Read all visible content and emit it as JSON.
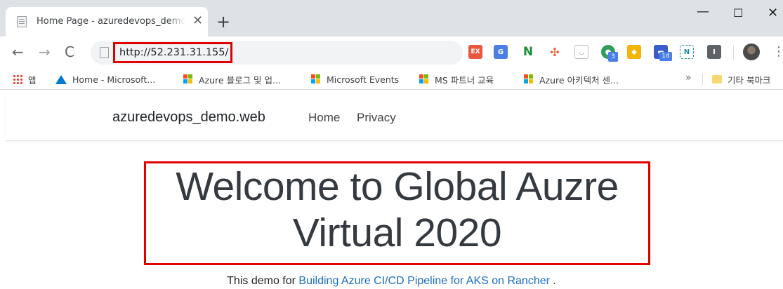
{
  "browser": {
    "tab": {
      "title": "Home Page - azuredevops_demo.web",
      "close_glyph": "✕"
    },
    "new_tab_glyph": "+",
    "window_controls": {
      "minimize": "—",
      "maximize": "☐",
      "close": "✕"
    },
    "toolbar": {
      "back_glyph": "←",
      "forward_glyph": "→",
      "reload_glyph": "C",
      "url": "http://52.231.31.155/",
      "menu_glyph": "⋮"
    },
    "extensions": [
      {
        "name": "ex-extension-icon",
        "label": "EX",
        "color": "#e8573f"
      },
      {
        "name": "translate-extension-icon",
        "label": "G",
        "color": "#4a7fe5"
      },
      {
        "name": "n-extension-icon",
        "label": "N",
        "color": "#1b8f3a"
      },
      {
        "name": "org-chart-extension-icon",
        "label": "✣",
        "color": "#e6562a"
      },
      {
        "name": "pocket-extension-icon",
        "label": "◡",
        "color": "#999999"
      },
      {
        "name": "chat-extension-icon",
        "label": "●",
        "color": "#2e9e5a",
        "badge": "3"
      },
      {
        "name": "puzzle-extension-icon",
        "label": "◆",
        "color": "#f5b400"
      },
      {
        "name": "calendar-extension-icon",
        "label": "▬",
        "color": "#3a5dc9",
        "badge": "1d"
      },
      {
        "name": "notion-extension-icon",
        "label": "N",
        "color": "#1a8aa8"
      },
      {
        "name": "reader-extension-icon",
        "label": "I",
        "color": "#5f6368"
      }
    ],
    "bookmarks": {
      "items": [
        {
          "label": "앱",
          "icon": "apps-grid-icon"
        },
        {
          "label": "Home - Microsoft...",
          "icon": "azure-logo-icon"
        },
        {
          "label": "Azure 블로그 및 업...",
          "icon": "microsoft-logo-icon"
        },
        {
          "label": "Microsoft Events",
          "icon": "microsoft-logo-icon"
        },
        {
          "label": "MS 파트너 교육",
          "icon": "microsoft-logo-icon"
        },
        {
          "label": "Azure 아키텍처 센...",
          "icon": "microsoft-logo-icon"
        }
      ],
      "more_glyph": "»",
      "other_bookmarks": "기타 북마크"
    }
  },
  "site": {
    "brand": "azuredevops_demo.web",
    "nav": {
      "home": "Home",
      "privacy": "Privacy"
    },
    "hero_line1": "Welcome to Global Auzre",
    "hero_line2": "Virtual 2020",
    "demo_prefix": "This demo for ",
    "demo_link": "Building Azure CI/CD Pipeline for AKS on Rancher",
    "demo_suffix": " ."
  },
  "colors": {
    "highlight_border": "#e00000",
    "link": "#1b6ec2",
    "tabstrip": "#dee1e6"
  }
}
